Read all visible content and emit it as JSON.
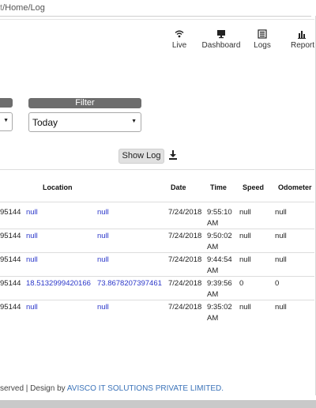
{
  "address_bar": {
    "text_dim": "t",
    "text_path": "/Home/Log"
  },
  "nav": {
    "items": [
      {
        "label": "Live",
        "icon": "wifi-icon"
      },
      {
        "label": "Dashboard",
        "icon": "monitor-icon"
      },
      {
        "label": "Logs",
        "icon": "list-icon"
      },
      {
        "label": "Report",
        "icon": "bar-chart-icon"
      }
    ]
  },
  "filter": {
    "label": "Filter",
    "selected": "Today"
  },
  "actions": {
    "show_log": "Show Log"
  },
  "table": {
    "headers": [
      "Location",
      "Date",
      "Time",
      "Speed",
      "Odometer"
    ],
    "rows": [
      {
        "id": "95144",
        "lat": "null",
        "lng": "null",
        "date": "7/24/2018",
        "time1": "9:55:10",
        "time2": "AM",
        "speed": "null",
        "odometer": "null"
      },
      {
        "id": "95144",
        "lat": "null",
        "lng": "null",
        "date": "7/24/2018",
        "time1": "9:50:02",
        "time2": "AM",
        "speed": "null",
        "odometer": "null"
      },
      {
        "id": "95144",
        "lat": "null",
        "lng": "null",
        "date": "7/24/2018",
        "time1": "9:44:54",
        "time2": "AM",
        "speed": "null",
        "odometer": "null"
      },
      {
        "id": "95144",
        "lat": "18.5132999420166",
        "lng": "73.8678207397461",
        "date": "7/24/2018",
        "time1": "9:39:56",
        "time2": "AM",
        "speed": "0",
        "odometer": "0"
      },
      {
        "id": "95144",
        "lat": "null",
        "lng": "null",
        "date": "7/24/2018",
        "time1": "9:35:02",
        "time2": "AM",
        "speed": "null",
        "odometer": "null"
      }
    ]
  },
  "footer": {
    "text": "served | Design by ",
    "brand": "AVISCO IT SOLUTIONS PRIVATE LIMITED."
  }
}
